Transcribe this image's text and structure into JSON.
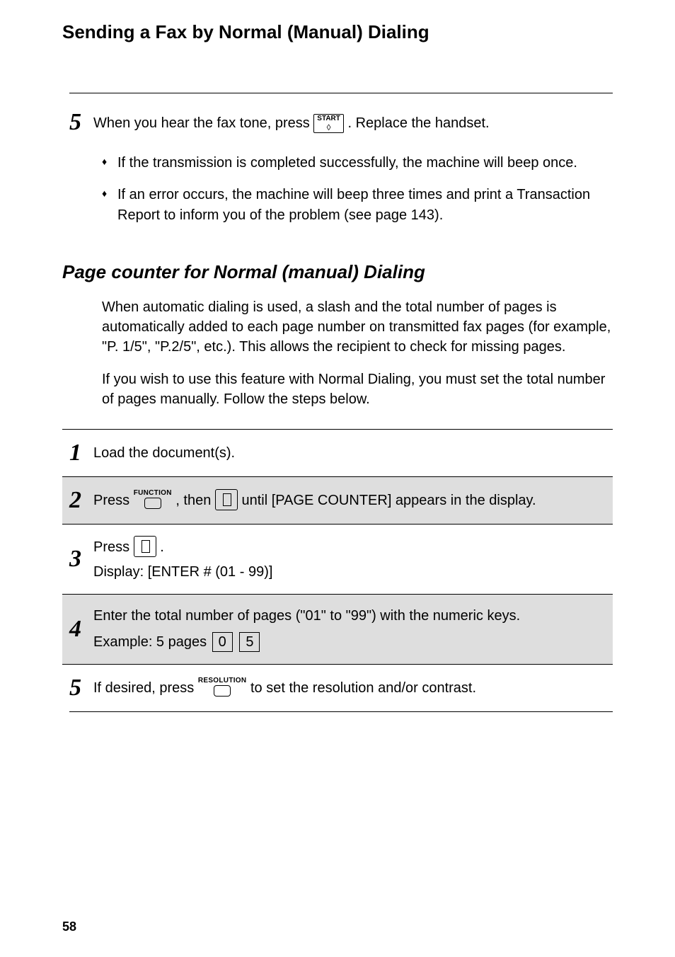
{
  "section_title": "Sending a Fax by Normal (Manual) Dialing",
  "top_step": {
    "num": "5",
    "text_before": "When you hear the fax tone, press ",
    "start_key_top": "START",
    "start_key_symbol": "◊",
    "text_after": ". Replace the handset."
  },
  "bullets": [
    "If the transmission is completed successfully, the machine will beep once.",
    "If an error occurs, the machine will beep three times and print a Transaction Report to inform you of the problem (see page 143)."
  ],
  "subhead": "Page counter for Normal (manual) Dialing",
  "para1": "When automatic dialing is used,  a slash and the total number of pages is automatically added to each page number on transmitted fax pages (for example, \"P. 1/5\", \"P.2/5\", etc.). This allows the recipient to check for missing pages.",
  "para2": "If you wish to use this feature with Normal Dialing, you must set the total number of pages manually. Follow the steps below.",
  "steps": [
    {
      "num": "1",
      "text": "Load the document(s)."
    },
    {
      "num": "2",
      "press": "Press ",
      "function_label": "FUNCTION",
      "then": ", then ",
      "tail": " until [PAGE COUNTER] appears in the display."
    },
    {
      "num": "3",
      "press": "Press ",
      "period": ".",
      "display_line": "Display: [ENTER # (01 - 99)]"
    },
    {
      "num": "4",
      "line1": "Enter the total number of pages (\"01\" to \"99\") with the numeric keys.",
      "example_prefix": "Example: 5 pages ",
      "key0": "0",
      "key5": "5"
    },
    {
      "num": "5",
      "prefix": "If desired, press ",
      "resolution_label": "RESOLUTION",
      "suffix": " to set the resolution and/or contrast."
    }
  ],
  "page_number": "58"
}
